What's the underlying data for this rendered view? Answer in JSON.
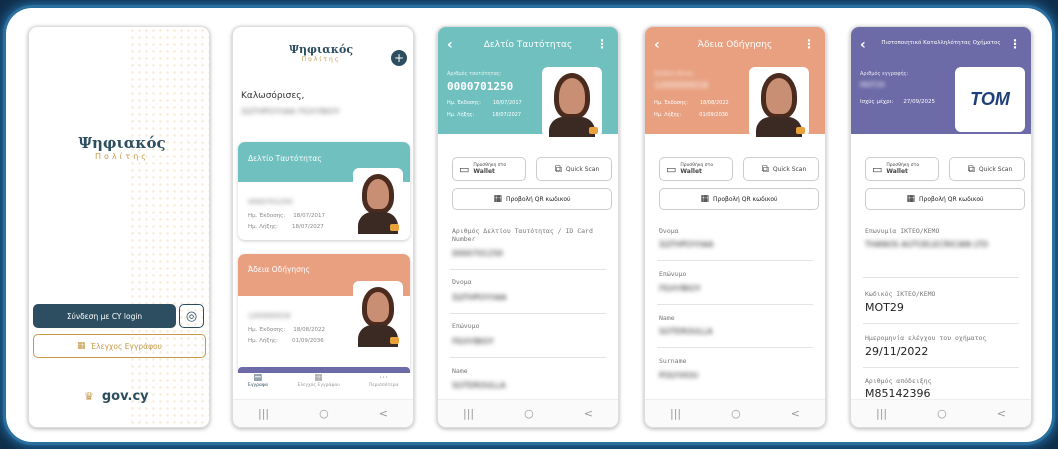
{
  "brand": {
    "word1": "Ψηφιακός",
    "word2": "Πολίτης"
  },
  "login": {
    "cy_login": "Σύνδεση με CY login",
    "verify": "Έλεγχος Εγγράφου",
    "govcy": "gov.cy"
  },
  "home": {
    "greeting": "Καλωσόρισες,",
    "name": "ΣΩΤΗΡΟΥΛΑΑ ΠΟΛΥΒΙΟΥ",
    "card_id": {
      "title": "Δελτίο Ταυτότητας",
      "number": "0000701250",
      "issue_label": "Ημ. Έκδοσης:",
      "issue": "18/07/2017",
      "expiry_label": "Ημ. Λήξης:",
      "expiry": "18/07/2027"
    },
    "card_dl": {
      "title": "Άδεια Οδήγησης",
      "number": "1/00000016",
      "issue_label": "Ημ. Έκδοσης:",
      "issue": "18/08/2022",
      "expiry_label": "Ημ. Λήξης:",
      "expiry": "01/09/2036"
    },
    "nav": [
      "Έγγραφα",
      "Έλεγχος Εγγράφου",
      "Περισσότερα"
    ]
  },
  "id_screen": {
    "title": "Δελτίο Ταυτότητας",
    "num_label": "Αριθμός ταυτότητας:",
    "num": "0000701250",
    "issue_label": "Ημ. Έκδοσης:",
    "issue": "18/07/2017",
    "expiry_label": "Ημ. Λήξης:",
    "expiry": "18/07/2027",
    "wallet_top": "Προσθήκη στο",
    "wallet": "Wallet",
    "quick": "Quick Scan",
    "qr": "Προβολή QR κωδικού",
    "f1_label": "Αριθμός Δελτίου Ταυτότητας / ID Card Number",
    "f1": "0000701250",
    "f2_label": "Όνομα",
    "f2": "ΣΩΤΗΡΟΥΛΑΑ",
    "f3_label": "Επώνυμο",
    "f3": "ΠΟΛΥΒΙΟΥ",
    "f4_label": "Name",
    "f4": "SOTEROULLA"
  },
  "dl_screen": {
    "title": "Άδεια Οδήγησης",
    "num_label": "Αριθμός άδειας:",
    "num": "1/00000016",
    "issue_label": "Ημ. Έκδοσης:",
    "issue": "18/08/2022",
    "expiry_label": "Ημ. Λήξης:",
    "expiry": "01/09/2036",
    "f1_label": "Όνομα",
    "f1": "ΣΩΤΗΡΟΥΛΑΑ",
    "f2_label": "Επώνυμο",
    "f2": "ΠΟΛΥΒΙΟΥ",
    "f3_label": "Name",
    "f3": "SOTEROULLA",
    "f4_label": "Surname",
    "f4": "POLYVIOU"
  },
  "cert_screen": {
    "title": "Πιστοποιητικό Καταλληλότητας Οχήματος",
    "num_label": "Αριθμός εγγραφής:",
    "num": "MOT29",
    "valid_label": "Ισχύς μέχρι:",
    "valid": "27/09/2025",
    "logo": "TOM",
    "f1_label": "Επωνυμία ΙΚΤΕΟ/ΚΕΜΟ",
    "f1": "THANOS AUTOELECRICIAN LTD",
    "f2_label": "Κωδικός ΙΚΤΕΟ/ΚΕΜΟ",
    "f2": "MOT29",
    "f3_label": "Ημερομηνία ελέγχου του οχήματος",
    "f3": "29/11/2022",
    "f4_label": "Αριθμός απόδειξης",
    "f4": "M85142396"
  },
  "colors": {
    "teal": "#6fc0bf",
    "peach": "#e8a080",
    "purple": "#6c6aa7",
    "navy": "#2c4e60",
    "gold": "#c49a4a"
  }
}
